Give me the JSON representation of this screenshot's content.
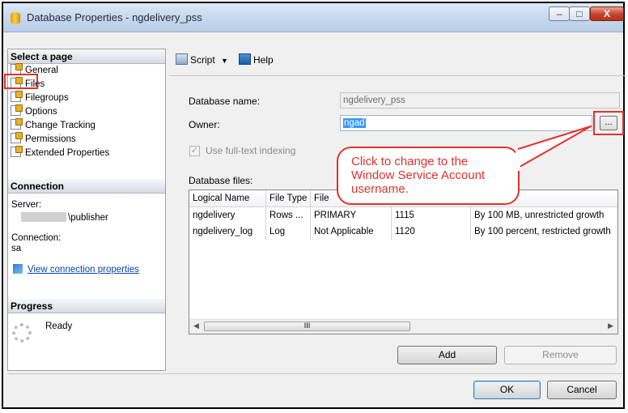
{
  "window": {
    "title": "Database Properties - ngdelivery_pss",
    "min_glyph": "–",
    "max_glyph": "□",
    "close_glyph": "X"
  },
  "left_pane": {
    "select_page_header": "Select a page",
    "pages": [
      {
        "label": "General"
      },
      {
        "label": "Files"
      },
      {
        "label": "Filegroups"
      },
      {
        "label": "Options"
      },
      {
        "label": "Change Tracking"
      },
      {
        "label": "Permissions"
      },
      {
        "label": "Extended Properties"
      }
    ],
    "connection_header": "Connection",
    "server_label": "Server:",
    "server_value": "\\publisher",
    "connection_label": "Connection:",
    "connection_value": "sa",
    "view_connection_link": "View connection properties",
    "progress_header": "Progress",
    "progress_status": "Ready"
  },
  "toolbar": {
    "script_label": "Script",
    "script_dropdown_glyph": "▼",
    "help_label": "Help"
  },
  "form": {
    "database_name_label": "Database name:",
    "database_name_value": "ngdelivery_pss",
    "owner_label": "Owner:",
    "owner_value": "ngad",
    "browse_label": "...",
    "fulltext_label": "Use full-text indexing",
    "fulltext_checked": true,
    "database_files_label": "Database files:"
  },
  "grid": {
    "columns": [
      "Logical Name",
      "File Type",
      "File"
    ],
    "rows": [
      {
        "logical_name": "ngdelivery",
        "file_type": "Rows ...",
        "filegroup": "PRIMARY",
        "size": "1115",
        "autogrowth": "By 100 MB, unrestricted growth"
      },
      {
        "logical_name": "ngdelivery_log",
        "file_type": "Log",
        "filegroup": "Not Applicable",
        "size": "1120",
        "autogrowth": "By 100 percent, restricted growth"
      }
    ],
    "scroll_thumb_glyph": "III"
  },
  "buttons": {
    "add": "Add",
    "remove": "Remove",
    "ok": "OK",
    "cancel": "Cancel"
  },
  "callout": {
    "text": "Click to change to the Window Service Account username."
  },
  "colors": {
    "highlight_red": "#e0322a",
    "selection_blue": "#3399ff"
  }
}
